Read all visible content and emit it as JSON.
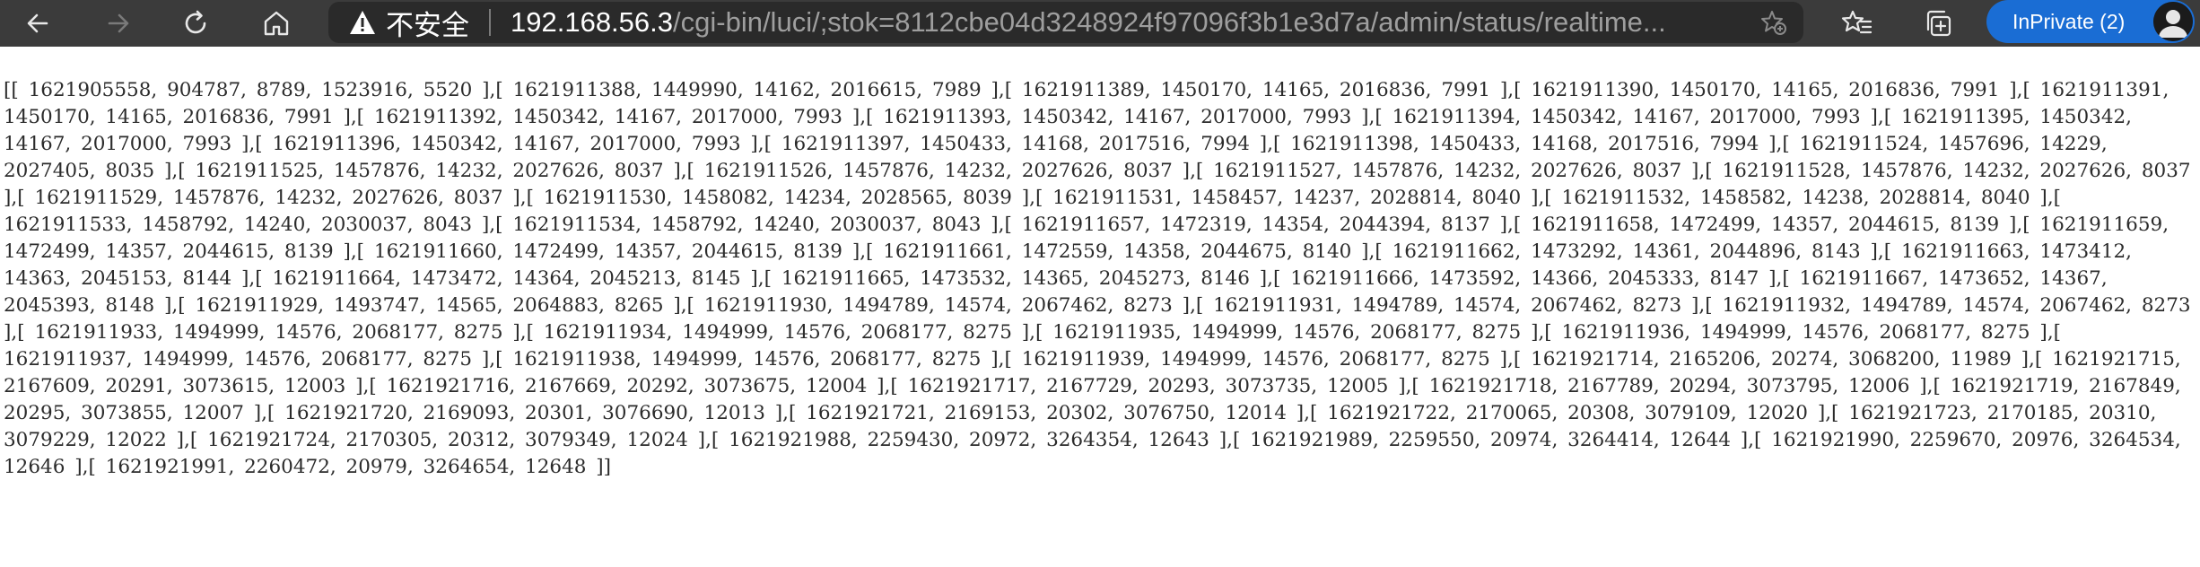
{
  "browser": {
    "security_label": "不安全",
    "url_host": "192.168.56.3",
    "url_path": "/cgi-bin/luci/;stok=8112cbe04d3248924f97096f3b1e3d7a/admin/status/realtime...",
    "inprivate_label": "InPrivate (2)",
    "icons": {
      "back": "back-arrow-icon",
      "forward": "forward-arrow-icon",
      "refresh": "refresh-icon",
      "home": "home-icon",
      "warning": "warning-icon",
      "add_favorite": "add-favorite-icon",
      "favorites": "favorites-icon",
      "collections": "collections-icon",
      "avatar": "avatar-icon"
    },
    "colors": {
      "toolbar": "#3b3b3b",
      "address_bar": "#2a2a2a",
      "inprivate": "#1a6dd4"
    }
  },
  "page": {
    "raw_text": "[[ 1621905558, 904787, 8789, 1523916, 5520 ],[ 1621911388, 1449990, 14162, 2016615, 7989 ],[ 1621911389, 1450170, 14165, 2016836, 7991 ],[ 1621911390, 1450170, 14165, 2016836, 7991 ],[ 1621911391, 1450170, 14165, 2016836, 7991 ],[ 1621911392, 1450342, 14167, 2017000, 7993 ],[ 1621911393, 1450342, 14167, 2017000, 7993 ],[ 1621911394, 1450342, 14167, 2017000, 7993 ],[ 1621911395, 1450342, 14167, 2017000, 7993 ],[ 1621911396, 1450342, 14167, 2017000, 7993 ],[ 1621911397, 1450433, 14168, 2017516, 7994 ],[ 1621911398, 1450433, 14168, 2017516, 7994 ],[ 1621911524, 1457696, 14229, 2027405, 8035 ],[ 1621911525, 1457876, 14232, 2027626, 8037 ],[ 1621911526, 1457876, 14232, 2027626, 8037 ],[ 1621911527, 1457876, 14232, 2027626, 8037 ],[ 1621911528, 1457876, 14232, 2027626, 8037 ],[ 1621911529, 1457876, 14232, 2027626, 8037 ],[ 1621911530, 1458082, 14234, 2028565, 8039 ],[ 1621911531, 1458457, 14237, 2028814, 8040 ],[ 1621911532, 1458582, 14238, 2028814, 8040 ],[ 1621911533, 1458792, 14240, 2030037, 8043 ],[ 1621911534, 1458792, 14240, 2030037, 8043 ],[ 1621911657, 1472319, 14354, 2044394, 8137 ],[ 1621911658, 1472499, 14357, 2044615, 8139 ],[ 1621911659, 1472499, 14357, 2044615, 8139 ],[ 1621911660, 1472499, 14357, 2044615, 8139 ],[ 1621911661, 1472559, 14358, 2044675, 8140 ],[ 1621911662, 1473292, 14361, 2044896, 8143 ],[ 1621911663, 1473412, 14363, 2045153, 8144 ],[ 1621911664, 1473472, 14364, 2045213, 8145 ],[ 1621911665, 1473532, 14365, 2045273, 8146 ],[ 1621911666, 1473592, 14366, 2045333, 8147 ],[ 1621911667, 1473652, 14367, 2045393, 8148 ],[ 1621911929, 1493747, 14565, 2064883, 8265 ],[ 1621911930, 1494789, 14574, 2067462, 8273 ],[ 1621911931, 1494789, 14574, 2067462, 8273 ],[ 1621911932, 1494789, 14574, 2067462, 8273 ],[ 1621911933, 1494999, 14576, 2068177, 8275 ],[ 1621911934, 1494999, 14576, 2068177, 8275 ],[ 1621911935, 1494999, 14576, 2068177, 8275 ],[ 1621911936, 1494999, 14576, 2068177, 8275 ],[ 1621911937, 1494999, 14576, 2068177, 8275 ],[ 1621911938, 1494999, 14576, 2068177, 8275 ],[ 1621911939, 1494999, 14576, 2068177, 8275 ],[ 1621921714, 2165206, 20274, 3068200, 11989 ],[ 1621921715, 2167609, 20291, 3073615, 12003 ],[ 1621921716, 2167669, 20292, 3073675, 12004 ],[ 1621921717, 2167729, 20293, 3073735, 12005 ],[ 1621921718, 2167789, 20294, 3073795, 12006 ],[ 1621921719, 2167849, 20295, 3073855, 12007 ],[ 1621921720, 2169093, 20301, 3076690, 12013 ],[ 1621921721, 2169153, 20302, 3076750, 12014 ],[ 1621921722, 2170065, 20308, 3079109, 12020 ],[ 1621921723, 2170185, 20310, 3079229, 12022 ],[ 1621921724, 2170305, 20312, 3079349, 12024 ],[ 1621921988, 2259430, 20972, 3264354, 12643 ],[ 1621921989, 2259550, 20974, 3264414, 12644 ],[ 1621921990, 2259670, 20976, 3264534, 12646 ],[ 1621921991, 2260472, 20979, 3264654, 12648 ]]"
  }
}
